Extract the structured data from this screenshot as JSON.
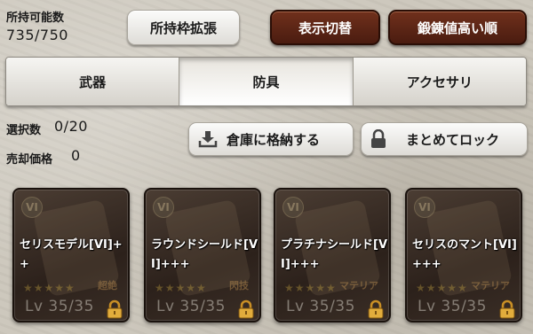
{
  "inventory": {
    "capacity_label": "所持可能数",
    "capacity_value": "735/750"
  },
  "header": {
    "expand_label": "所持枠拡張",
    "toggle_label": "表示切替",
    "sort_label": "鍛錬値高い順"
  },
  "tabs": [
    {
      "label": "武器",
      "active": false
    },
    {
      "label": "防具",
      "active": true
    },
    {
      "label": "アクセサリ",
      "active": false
    }
  ],
  "selection": {
    "selected_label": "選択数",
    "selected_value": "0/20",
    "price_label": "売却価格",
    "price_value": "0"
  },
  "actions": {
    "store_label": "倉庫に格納する",
    "store_icon": "download-tray-icon",
    "lock_label": "まとめてロック",
    "lock_icon": "lock-icon"
  },
  "items": [
    {
      "name": "セリスモデル[VI]++",
      "level": "Lv 35/35",
      "rank": "VI",
      "tag": "超絶",
      "locked": true
    },
    {
      "name": "ラウンドシールド[VI]+++",
      "level": "Lv 35/35",
      "rank": "VI",
      "tag": "閃技",
      "locked": true
    },
    {
      "name": "プラチナシールド[VI]+++",
      "level": "Lv 35/35",
      "rank": "VI",
      "tag": "マテリア",
      "locked": true
    },
    {
      "name": "セリスのマント[VI]+++",
      "level": "Lv 35/35",
      "rank": "VI",
      "tag": "マテリア",
      "locked": true
    }
  ],
  "colors": {
    "dark_button": "#5a2414",
    "lock_gold": "#d9a437",
    "card_bg": "#2c211b"
  }
}
